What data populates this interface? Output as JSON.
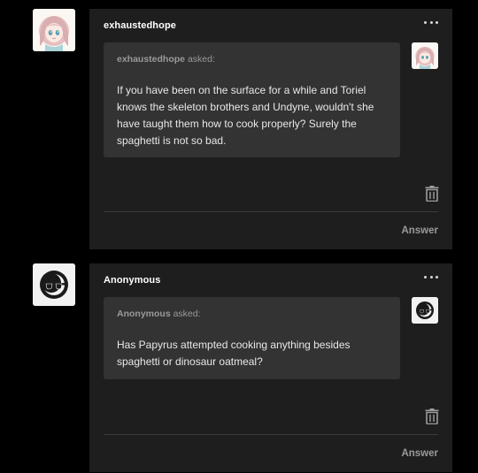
{
  "posts": [
    {
      "username": "exhaustedhope",
      "asker": "exhaustedhope",
      "asked_label": " asked:",
      "question": "If you have been on the surface for a while and Toriel knows the skeleton brothers and Undyne, wouldn't she have taught them how to cook properly? Surely the spaghetti is not so bad.",
      "answer_label": "Answer",
      "avatar_icon": "anime-girl-avatar",
      "more_icon": "ellipsis-icon",
      "delete_icon": "trash-icon"
    },
    {
      "username": "Anonymous",
      "asker": "Anonymous",
      "asked_label": " asked:",
      "question": "Has Papyrus attempted cooking anything besides spaghetti or dinosaur oatmeal?",
      "answer_label": "Answer",
      "avatar_icon": "anonymous-sunglasses-avatar",
      "more_icon": "ellipsis-icon",
      "delete_icon": "trash-icon"
    }
  ],
  "colors": {
    "page_bg": "#000000",
    "card_bg": "#1e1e1e",
    "bubble_bg": "#333333",
    "muted_text": "#9a9a9a",
    "text": "#e8e8e8"
  }
}
